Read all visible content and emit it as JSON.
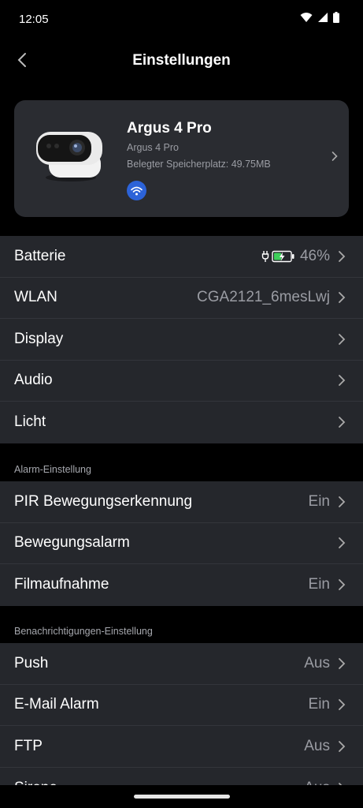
{
  "status_bar": {
    "time": "12:05"
  },
  "header": {
    "title": "Einstellungen"
  },
  "device": {
    "name": "Argus 4 Pro",
    "model": "Argus 4 Pro",
    "storage": "Belegter Speicherplatz: 49.75MB"
  },
  "settings": [
    {
      "label": "Batterie",
      "value": "46%",
      "battery_level": 0.46
    },
    {
      "label": "WLAN",
      "value": "CGA2121_6mesLwj"
    },
    {
      "label": "Display",
      "value": ""
    },
    {
      "label": "Audio",
      "value": ""
    },
    {
      "label": "Licht",
      "value": ""
    }
  ],
  "alarm_section": {
    "title": "Alarm-Einstellung",
    "rows": [
      {
        "label": "PIR Bewegungserkennung",
        "value": "Ein"
      },
      {
        "label": "Bewegungsalarm",
        "value": ""
      },
      {
        "label": "Filmaufnahme",
        "value": "Ein"
      }
    ]
  },
  "notify_section": {
    "title": "Benachrichtigungen-Einstellung",
    "rows": [
      {
        "label": "Push",
        "value": "Aus"
      },
      {
        "label": "E-Mail Alarm",
        "value": "Ein"
      },
      {
        "label": "FTP",
        "value": "Aus"
      },
      {
        "label": "Sirene",
        "value": "Aus"
      }
    ]
  },
  "colors": {
    "background": "#000000",
    "panel": "#25272c",
    "card": "#2a2c31",
    "accent": "#2c63d8",
    "battery_green": "#3ecf5a"
  }
}
